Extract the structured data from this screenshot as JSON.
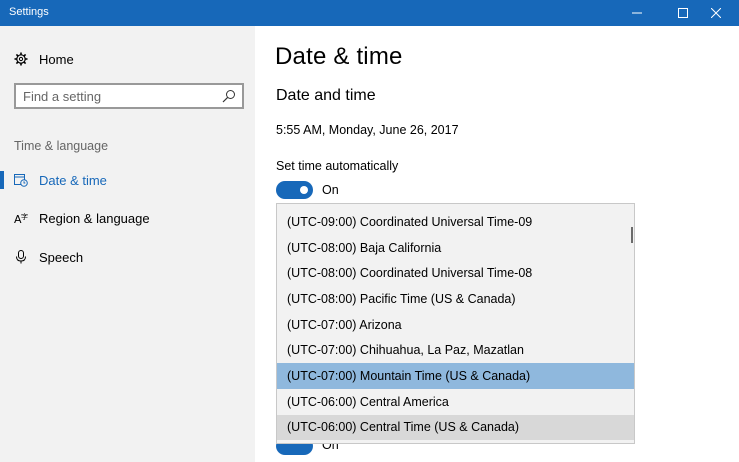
{
  "window": {
    "title": "Settings"
  },
  "sidebar": {
    "home_label": "Home",
    "search_placeholder": "Find a setting",
    "section_label": "Time & language",
    "items": [
      {
        "label": "Date & time",
        "icon": "calendar-clock-icon",
        "active": true
      },
      {
        "label": "Region & language",
        "icon": "language-icon",
        "active": false
      },
      {
        "label": "Speech",
        "icon": "microphone-icon",
        "active": false
      }
    ]
  },
  "main": {
    "page_title": "Date & time",
    "subheading": "Date and time",
    "current_datetime": "5:55 AM, Monday, June 26, 2017",
    "set_time_auto_label": "Set time automatically",
    "set_time_auto_state": "On",
    "second_toggle_state": "On"
  },
  "timezone_dropdown": {
    "options": [
      "(UTC-09:00) Coordinated Universal Time-09",
      "(UTC-08:00) Baja California",
      "(UTC-08:00) Coordinated Universal Time-08",
      "(UTC-08:00) Pacific Time (US & Canada)",
      "(UTC-07:00) Arizona",
      "(UTC-07:00) Chihuahua, La Paz, Mazatlan",
      "(UTC-07:00) Mountain Time (US & Canada)",
      "(UTC-06:00) Central America",
      "(UTC-06:00) Central Time (US & Canada)"
    ],
    "selected_index": 6,
    "hovered_index": 8
  },
  "colors": {
    "accent": "#1768b9",
    "sidebar_bg": "#f2f2f2",
    "selected_option_bg": "#8fb8dd",
    "hover_option_bg": "#d8d8d8"
  }
}
